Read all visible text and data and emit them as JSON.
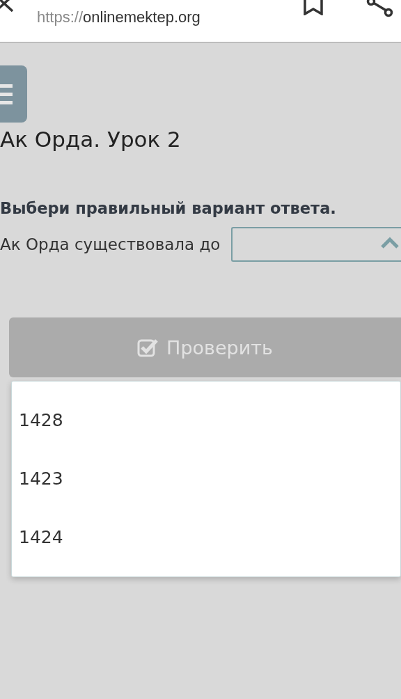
{
  "browser_bar": {
    "url_scheme": "https://",
    "url_host": "onlinemektep.org"
  },
  "lesson": {
    "title": "Ак Орда. Урок 2"
  },
  "question": {
    "instruction": "Выбери правильный вариант ответа.",
    "prompt": "Ак Орда существовала до",
    "select": {
      "expanded": true
    }
  },
  "check_button": {
    "label": "Проверить",
    "disabled": true
  },
  "dropdown_options": [
    {
      "label": "1428",
      "selected": false
    },
    {
      "label": "1423",
      "selected": false
    },
    {
      "label": "1424",
      "selected": false
    }
  ]
}
